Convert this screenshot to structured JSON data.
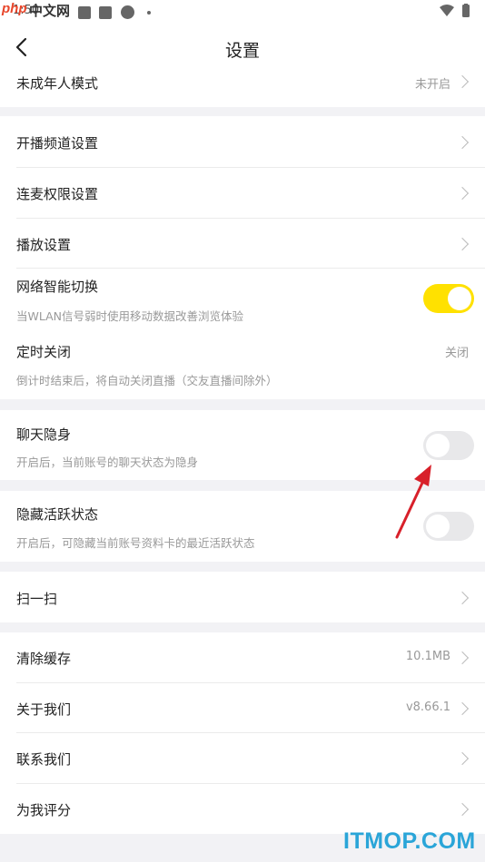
{
  "status_bar": {
    "time": "1:50"
  },
  "watermark_top": {
    "php": "php",
    "cn": "中文网"
  },
  "header": {
    "title": "设置"
  },
  "rows": [
    {
      "label": "未成年人模式",
      "value": "未开启"
    },
    {
      "label": "开播频道设置"
    },
    {
      "label": "连麦权限设置"
    },
    {
      "label": "播放设置"
    },
    {
      "label": "网络智能切换",
      "sub": "当WLAN信号弱时使用移动数据改善浏览体验",
      "toggle": "on"
    },
    {
      "label": "定时关闭",
      "sub": "倒计时结束后，将自动关闭直播（交友直播间除外）",
      "value": "关闭"
    },
    {
      "label": "聊天隐身",
      "sub": "开启后，当前账号的聊天状态为隐身",
      "toggle": "off"
    },
    {
      "label": "隐藏活跃状态",
      "sub": "开启后，可隐藏当前账号资料卡的最近活跃状态",
      "toggle": "off"
    },
    {
      "label": "扫一扫"
    },
    {
      "label": "清除缓存",
      "value": "10.1MB"
    },
    {
      "label": "关于我们",
      "value": "v8.66.1"
    },
    {
      "label": "联系我们"
    },
    {
      "label": "为我评分"
    }
  ],
  "watermark_bottom": "ITMOP.COM",
  "colors": {
    "accent": "#ffe100",
    "annotation_arrow": "#d8202a",
    "watermark_blue": "#2aa5d8"
  }
}
